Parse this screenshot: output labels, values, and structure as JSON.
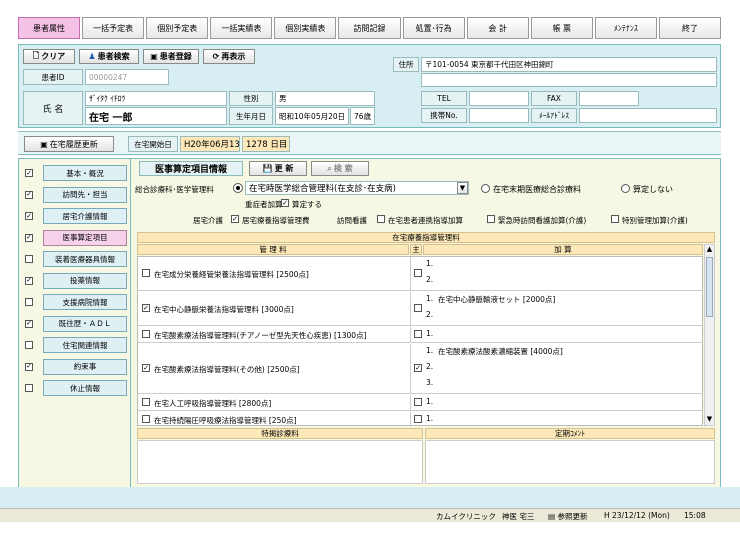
{
  "tabs": [
    "患者属性",
    "一括予定表",
    "個別予定表",
    "一括実績表",
    "個別実績表",
    "訪問記録",
    "処置･行為",
    "会 計",
    "帳 票",
    "ﾒﾝﾃﾅﾝｽ",
    "終了"
  ],
  "toolbar": {
    "clear": "クリア",
    "search": "患者検索",
    "register": "患者登録",
    "redisplay": "再表示"
  },
  "patient": {
    "id_label": "患者ID",
    "id_value": "00000247",
    "name_label": "氏 名",
    "kana": "ｻﾞｲﾀｸ ｲﾁﾛｳ",
    "name": "在宅 一郎",
    "sex_label": "性別",
    "sex": "男",
    "dob_label": "生年月日",
    "dob": "昭和10年05月20日",
    "age": "76歳",
    "address_label": "住所",
    "address": "〒101-0054 東京都千代田区神田錦町",
    "tel_label": "TEL",
    "fax_label": "FAX",
    "mobile_label": "携帯No.",
    "email_label": "ﾒｰﾙｱﾄﾞﾚｽ"
  },
  "strip": {
    "update_btn": "在宅履歴更新",
    "start_label": "在宅開始日",
    "start_date": "H20年06月13日",
    "days": "1278 日目"
  },
  "sidebar": [
    {
      "label": "基本・概況",
      "checked": true
    },
    {
      "label": "訪問先・担当",
      "checked": true
    },
    {
      "label": "居宅介護情報",
      "checked": true
    },
    {
      "label": "医事算定項目",
      "checked": true
    },
    {
      "label": "装着医療器具情報",
      "checked": false
    },
    {
      "label": "投薬情報",
      "checked": true
    },
    {
      "label": "支援病院情報",
      "checked": false
    },
    {
      "label": "既往歴・ＡＤＬ",
      "checked": true
    },
    {
      "label": "住宅関連情報",
      "checked": false
    },
    {
      "label": "約束事",
      "checked": true
    },
    {
      "label": "休止情報",
      "checked": false
    }
  ],
  "section": {
    "title": "医事算定項目情報",
    "update": "更 新",
    "search": "検 索"
  },
  "management": {
    "label": "総合診療科･医学管理料",
    "selected": "在宅時医学総合管理料(在支診･在支病)",
    "option2": "在宅末期医療総合診療料",
    "option3": "算定しない",
    "severe_label": "重症者加算",
    "calc_label": "算定する",
    "kyotaku_label": "居宅介護",
    "kyotaku_check": "居宅療養指導管理費",
    "visit_label": "訪問看護",
    "visit_opts": [
      "在宅患者連携指導加算",
      "緊急時訪問看護加算(介護)",
      "特別管理加算(介護)"
    ]
  },
  "table": {
    "group_header": "在宅療養指導管理料",
    "col_fee": "管 理 料",
    "col_main": "主",
    "col_add": "加 算",
    "rows": [
      {
        "name": "在宅成分栄養経管栄養法指導管理料 [2500点]",
        "checked": false,
        "main": false,
        "adds": [
          "",
          ""
        ]
      },
      {
        "name": "在宅中心静脈栄養法指導管理料 [3000点]",
        "checked": true,
        "main": false,
        "adds": [
          "在宅中心静脈輸液セット [2000点]",
          ""
        ]
      },
      {
        "name": "在宅酸素療法指導管理料(チアノーゼ型先天性心疾患) [1300点]",
        "checked": false,
        "main": false,
        "adds": [
          ""
        ]
      },
      {
        "name": "在宅酸素療法指導管理料(その他) [2500点]",
        "checked": true,
        "main": true,
        "adds": [
          "在宅酸素療法酸素濃縮装置 [4000点]",
          "",
          ""
        ]
      },
      {
        "name": "在宅人工呼吸指導管理料 [2800点]",
        "checked": false,
        "main": false,
        "adds": [
          ""
        ]
      },
      {
        "name": "在宅持続陽圧呼吸療法指導管理料 [250点]",
        "checked": false,
        "main": false,
        "adds": [
          ""
        ]
      }
    ]
  },
  "footer": {
    "left": "特掲診療料",
    "right": "定期ｺﾒﾝﾄ"
  },
  "status": {
    "clinic": "カムイクリニック",
    "user": "神医 宅三",
    "ref": "参照更新",
    "datetime": "H 23/12/12 (Mon)",
    "time": "15:08"
  }
}
